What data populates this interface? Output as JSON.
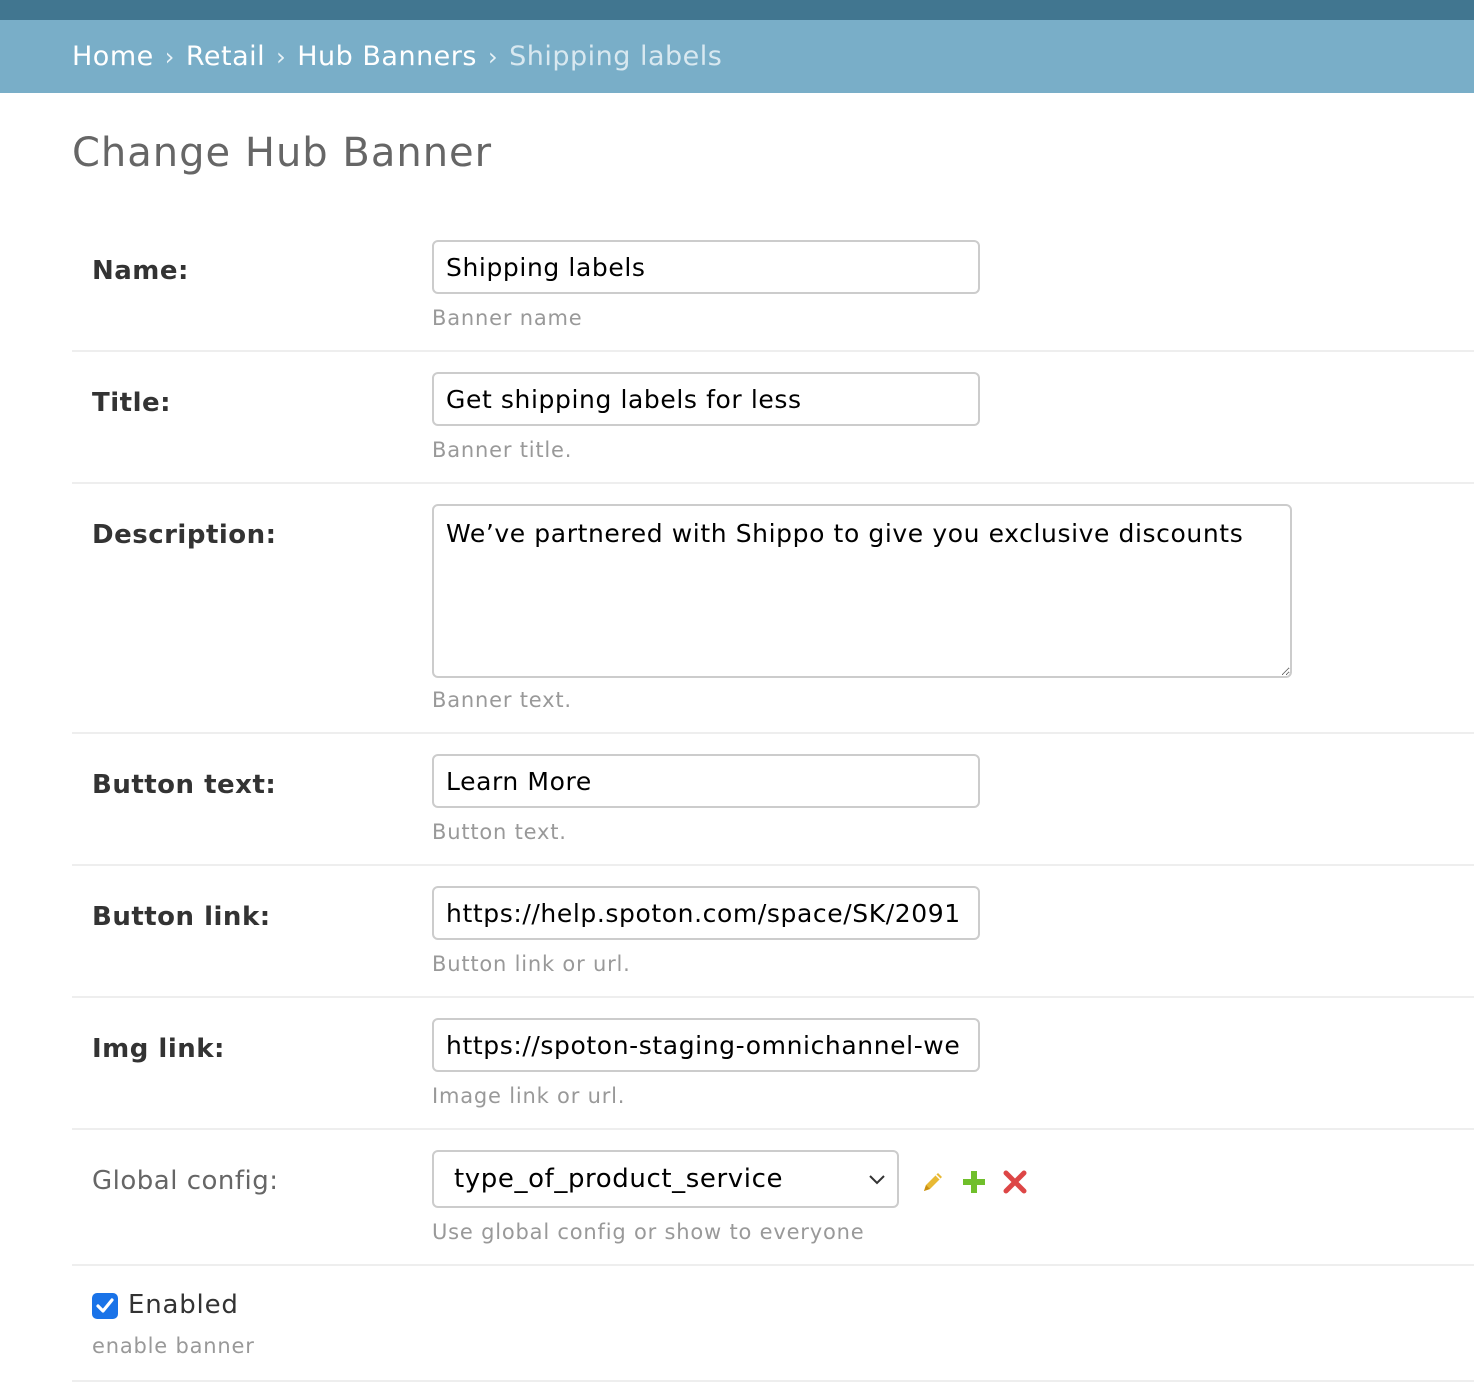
{
  "breadcrumbs": {
    "home": "Home",
    "retail": "Retail",
    "hub_banners": "Hub Banners",
    "current": "Shipping labels",
    "separator": "›"
  },
  "page_title": "Change Hub Banner",
  "fields": {
    "name": {
      "label": "Name:",
      "value": "Shipping labels",
      "help": "Banner name"
    },
    "title": {
      "label": "Title:",
      "value": "Get shipping labels for less",
      "help": "Banner title."
    },
    "description": {
      "label": "Description:",
      "value": "We’ve partnered with Shippo to give you exclusive discounts",
      "help": "Banner text."
    },
    "button_text": {
      "label": "Button text:",
      "value": "Learn More",
      "help": "Button text."
    },
    "button_link": {
      "label": "Button link:",
      "value": "https://help.spoton.com/space/SK/2091",
      "help": "Button link or url."
    },
    "img_link": {
      "label": "Img link:",
      "value": "https://spoton-staging-omnichannel-we",
      "help": "Image link or url."
    },
    "global_config": {
      "label": "Global config:",
      "selected": "type_of_product_service",
      "help": "Use global config or show to everyone"
    },
    "enabled": {
      "label": "Enabled",
      "checked": true,
      "help": "enable banner"
    }
  },
  "icons": {
    "edit": "pencil-icon",
    "add": "plus-icon",
    "delete": "x-icon"
  },
  "colors": {
    "header_dark": "#417690",
    "breadcrumb_bg": "#79aec8",
    "edit_icon": "#e8b934",
    "add_icon": "#70bf2b",
    "delete_icon": "#dd4646",
    "checkbox": "#1a73e8"
  }
}
